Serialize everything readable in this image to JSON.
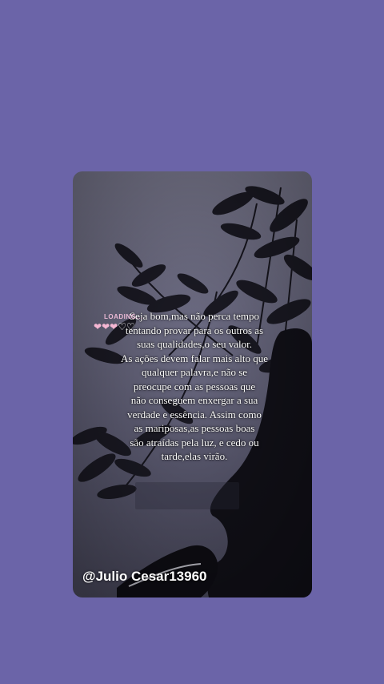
{
  "quote": {
    "lines": [
      "Seja bom,mas não perca tempo",
      "tentando provar para os outros as",
      "suas qualidades,o seu valor.",
      "As ações devem falar mais alto que",
      "qualquer palavra,e não se",
      "preocupe com as pessoas que",
      "não conseguem enxergar a sua",
      "verdade e essência. Assim como",
      "as mariposas,as pessoas boas",
      "são atraídas pela luz, e cedo ou",
      "tarde,elas virão."
    ]
  },
  "loading": {
    "label": "LOADING...",
    "hearts": "3 of 5 filled",
    "filled_count": 3,
    "total_count": 5
  },
  "handle": "@Julio Cesar13960",
  "colors": {
    "background": "#6b64a8",
    "heart_filled": "#f5b7d3",
    "loading_text": "#e9b8d4"
  }
}
